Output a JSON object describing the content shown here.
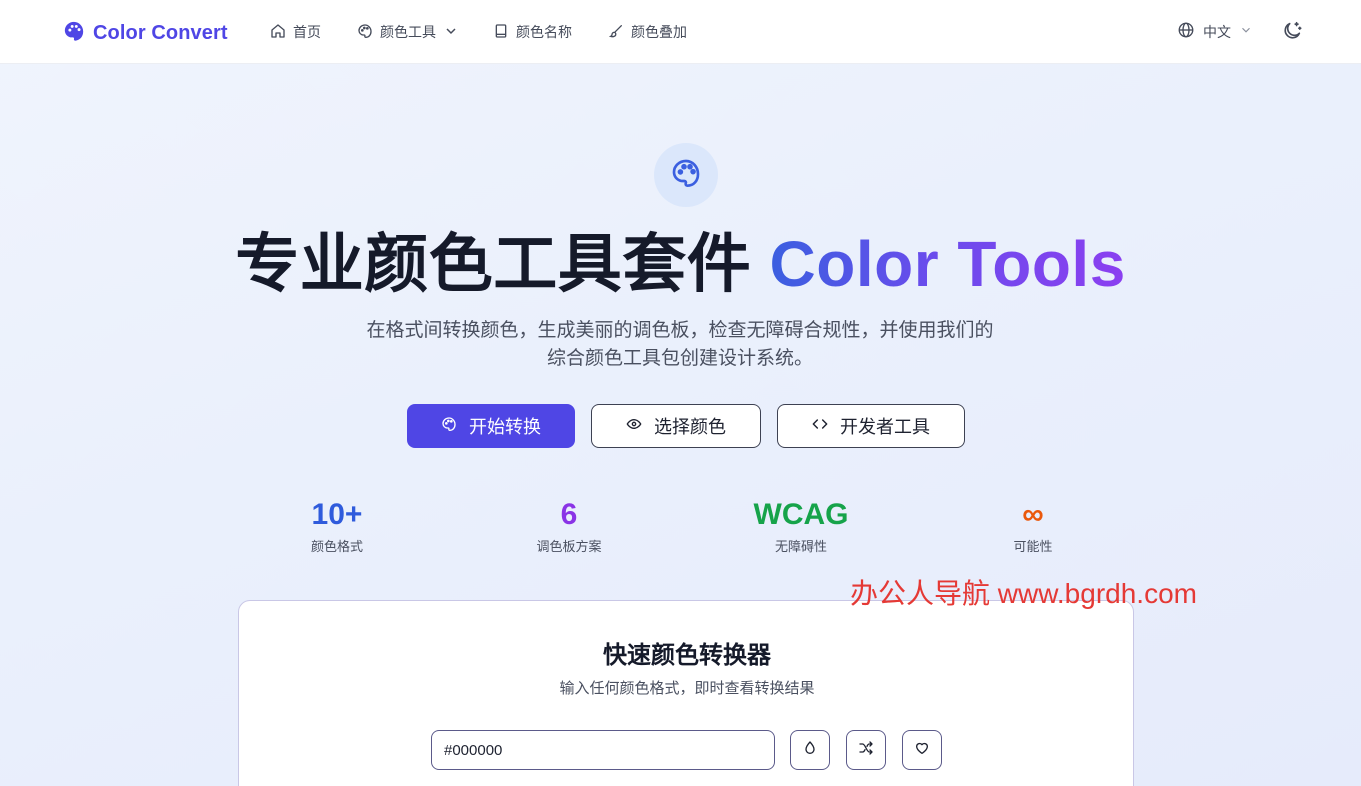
{
  "header": {
    "brand": "Color Convert",
    "nav": [
      {
        "label": "首页",
        "icon": "home-icon"
      },
      {
        "label": "颜色工具",
        "icon": "palette-icon",
        "dropdown": true
      },
      {
        "label": "颜色名称",
        "icon": "book-icon"
      },
      {
        "label": "颜色叠加",
        "icon": "brush-icon"
      }
    ],
    "language": "中文"
  },
  "hero": {
    "title_main": "专业颜色工具套件",
    "title_accent": "Color Tools",
    "subtitle_line1": "在格式间转换颜色，生成美丽的调色板，检查无障碍合规性，并使用我们的",
    "subtitle_line2": "综合颜色工具包创建设计系统。",
    "buttons": {
      "start": "开始转换",
      "pick": "选择颜色",
      "dev": "开发者工具"
    }
  },
  "stats": [
    {
      "value": "10+",
      "label": "颜色格式",
      "color": "#2f5bdc"
    },
    {
      "value": "6",
      "label": "调色板方案",
      "color": "#8a33e6"
    },
    {
      "value": "WCAG",
      "label": "无障碍性",
      "color": "#16a34a"
    },
    {
      "value": "∞",
      "label": "可能性",
      "color": "#ea580c"
    }
  ],
  "watermark": "办公人导航 www.bgrdh.com",
  "converter": {
    "title": "快速颜色转换器",
    "subtitle": "输入任何颜色格式，即时查看转换结果",
    "input_value": "#000000"
  },
  "colors": {
    "accent": "#4f46e5",
    "gradient_start": "#3b5fe0",
    "gradient_end": "#8b3ff0"
  }
}
